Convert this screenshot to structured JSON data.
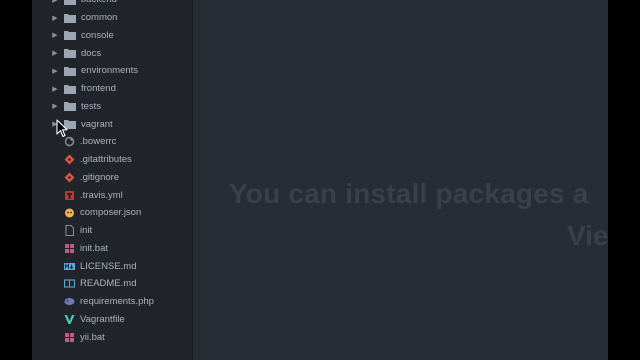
{
  "tree": {
    "folders": [
      {
        "name": "backend"
      },
      {
        "name": "common"
      },
      {
        "name": "console"
      },
      {
        "name": "docs"
      },
      {
        "name": "environments"
      },
      {
        "name": "frontend"
      },
      {
        "name": "tests"
      },
      {
        "name": "vagrant"
      }
    ],
    "files": [
      {
        "name": ".bowerrc",
        "icon": "bower-icon"
      },
      {
        "name": ".gitattributes",
        "icon": "git-icon"
      },
      {
        "name": ".gitignore",
        "icon": "git-icon"
      },
      {
        "name": ".travis.yml",
        "icon": "travis-icon"
      },
      {
        "name": "composer.json",
        "icon": "composer-icon"
      },
      {
        "name": "init",
        "icon": "file-icon"
      },
      {
        "name": "init.bat",
        "icon": "windows-icon"
      },
      {
        "name": "LICENSE.md",
        "icon": "markdown-icon"
      },
      {
        "name": "README.md",
        "icon": "book-icon"
      },
      {
        "name": "requirements.php",
        "icon": "php-icon"
      },
      {
        "name": "Vagrantfile",
        "icon": "vagrant-icon"
      },
      {
        "name": "yii.bat",
        "icon": "windows-icon"
      }
    ]
  },
  "editor": {
    "welcome_line1": "You can install packages a",
    "welcome_line2": "Vie"
  },
  "colors": {
    "sidebar_bg": "#21252b",
    "editor_bg": "#282c34",
    "text": "#abb2bf",
    "git": "#e0533d",
    "markdown": "#5aa7d6",
    "vagrant": "#4ec9b0",
    "windows": "#c05a8a"
  }
}
